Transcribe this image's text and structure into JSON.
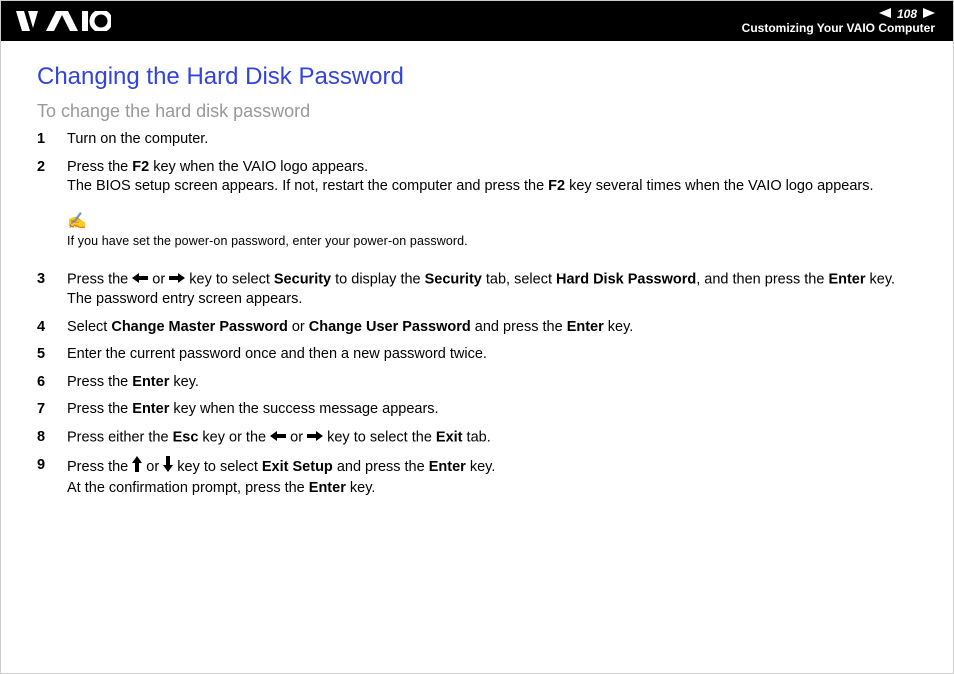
{
  "header": {
    "page_number": "108",
    "breadcrumb": "Customizing Your VAIO Computer"
  },
  "title": "Changing the Hard Disk Password",
  "subtitle": "To change the hard disk password",
  "steps": [
    {
      "num": "1",
      "html": "Turn on the computer."
    },
    {
      "num": "2",
      "html": "Press the <b>F2</b> key when the VAIO logo appears.<br>The BIOS setup screen appears. If not, restart the computer and press the <b>F2</b> key several times when the VAIO logo appears."
    },
    {
      "num": "",
      "html": "",
      "note": {
        "icon": "✍",
        "text": "If you have set the power-on password, enter your power-on password."
      }
    },
    {
      "num": "3",
      "html": "Press the <span class='arrow-glyph'>←</span> or <span class='arrow-glyph'>→</span> key to select <b>Security</b> to display the <b>Security</b> tab, select <b>Hard Disk Password</b>, and then press the <b>Enter</b> key.<br>The password entry screen appears."
    },
    {
      "num": "4",
      "html": "Select <b>Change Master Password</b> or <b>Change User Password</b> and press the <b>Enter</b> key."
    },
    {
      "num": "5",
      "html": "Enter the current password once and then a new password twice."
    },
    {
      "num": "6",
      "html": "Press the <b>Enter</b> key."
    },
    {
      "num": "7",
      "html": "Press the <b>Enter</b> key when the success message appears."
    },
    {
      "num": "8",
      "html": "Press either the <b>Esc</b> key or the <span class='arrow-glyph'>←</span> or <span class='arrow-glyph'>→</span> key to select the <b>Exit</b> tab."
    },
    {
      "num": "9",
      "html": "Press the <span class='arrow-glyph'>↑</span> or <span class='arrow-glyph'>↓</span> key to select <b>Exit Setup</b> and press the <b>Enter</b> key.<br>At the confirmation prompt, press the <b>Enter</b> key."
    }
  ]
}
